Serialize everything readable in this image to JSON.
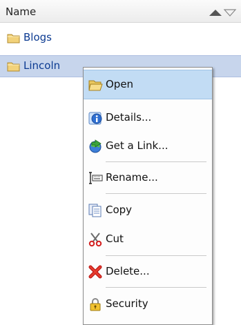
{
  "list": {
    "header": {
      "name_label": "Name"
    },
    "rows": [
      {
        "label": "Blogs"
      },
      {
        "label": "Lincoln"
      }
    ]
  },
  "context_menu": {
    "items": [
      {
        "label": "Open",
        "icon": "folder-open-icon"
      },
      {
        "label": "Details...",
        "icon": "info-icon"
      },
      {
        "label": "Get a Link...",
        "icon": "link-icon"
      },
      {
        "label": "Rename...",
        "icon": "rename-icon"
      },
      {
        "label": "Copy",
        "icon": "copy-icon"
      },
      {
        "label": "Cut",
        "icon": "scissors-icon"
      },
      {
        "label": "Delete...",
        "icon": "delete-icon"
      },
      {
        "label": "Security",
        "icon": "lock-icon"
      }
    ]
  },
  "colors": {
    "selection": "#c7d5ec",
    "menu_hover": "#c2dcf4",
    "link_text": "#0b3a91"
  }
}
